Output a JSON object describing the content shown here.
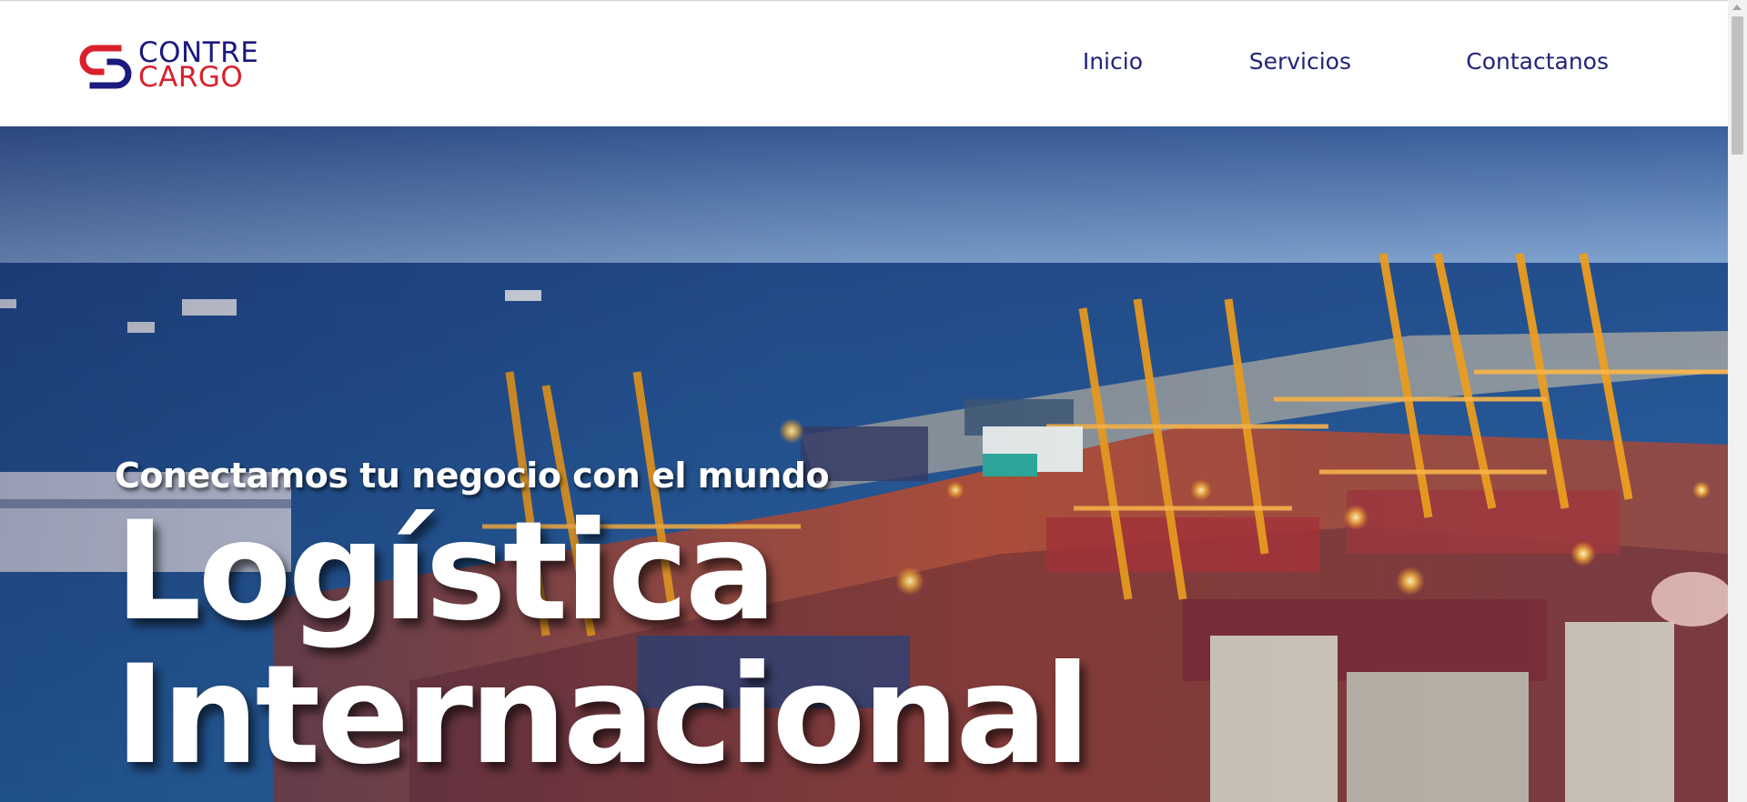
{
  "brand": {
    "line1": "CONTRE",
    "line2": "CARGO",
    "colors": {
      "blue": "#1b1a7e",
      "red": "#d9202a"
    }
  },
  "nav": {
    "items": [
      {
        "label": "Inicio"
      },
      {
        "label": "Servicios"
      },
      {
        "label": "Contactanos"
      }
    ]
  },
  "hero": {
    "subtitle": "Conectamos tu negocio con el mundo",
    "title_line1": "Logística",
    "title_line2": "Internacional",
    "background_image": "port-container-terminal-cranes-sea"
  }
}
